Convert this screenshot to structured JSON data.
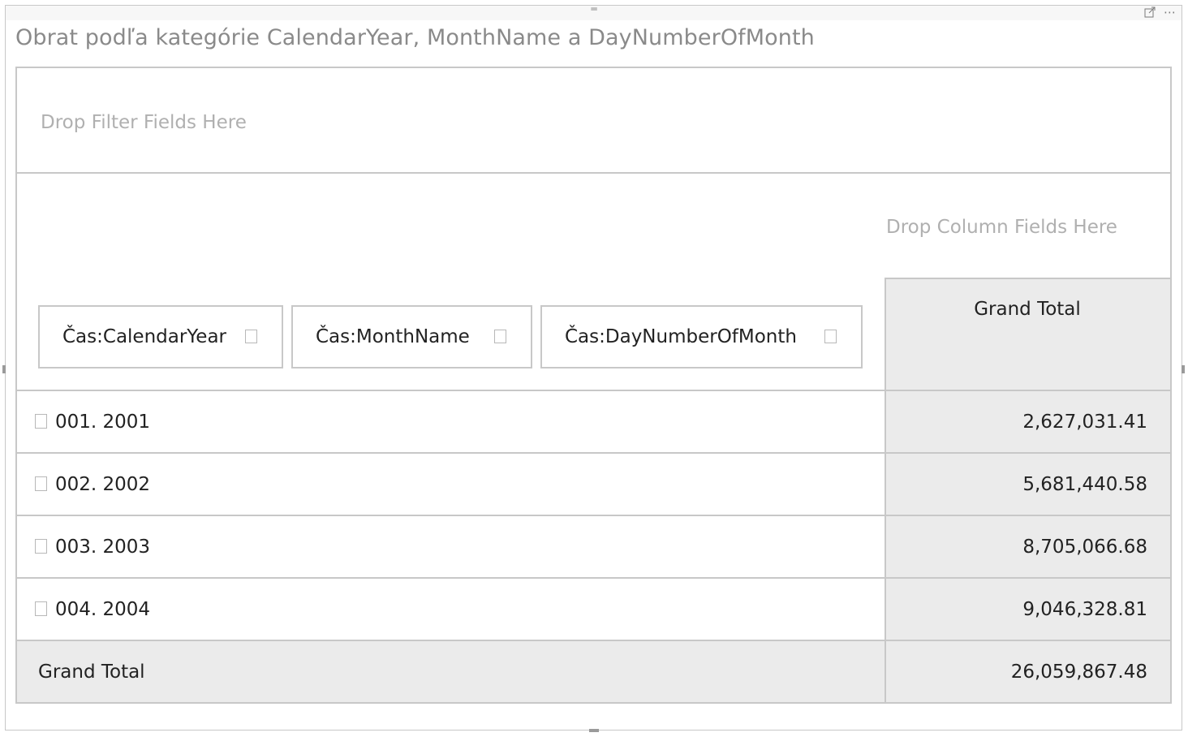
{
  "title": "Obrat podľa kategórie CalendarYear, MonthName a DayNumberOfMonth",
  "header_icons": {
    "focus": "focus-mode-icon",
    "more": "⋯"
  },
  "pivot": {
    "filter_placeholder": "Drop Filter Fields Here",
    "column_placeholder": "Drop Column Fields Here",
    "row_fields": [
      {
        "label": "Čas:CalendarYear"
      },
      {
        "label": "Čas:MonthName"
      },
      {
        "label": "Čas:DayNumberOfMonth"
      }
    ],
    "grand_total_header": "Grand Total",
    "rows": [
      {
        "label": "001. 2001",
        "value": "2,627,031.41"
      },
      {
        "label": "002. 2002",
        "value": "5,681,440.58"
      },
      {
        "label": "003. 2003",
        "value": "8,705,066.68"
      },
      {
        "label": "004. 2004",
        "value": "9,046,328.81"
      }
    ],
    "total": {
      "label": "Grand Total",
      "value": "26,059,867.48"
    }
  },
  "colors": {
    "border": "#c8c8c8",
    "total_background": "#ebebeb",
    "placeholder_text": "#b0b0b0",
    "title_text": "#8a8a8a"
  }
}
